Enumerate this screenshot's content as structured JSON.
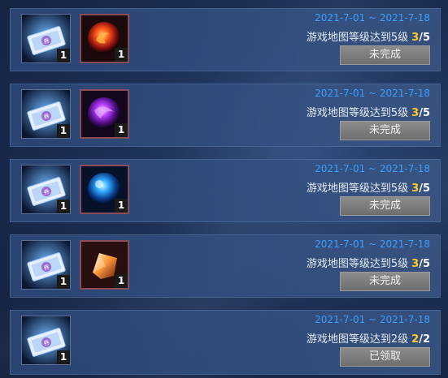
{
  "tasks": [
    {
      "date_range": "2021-7-01 ~ 2021-7-18",
      "task_text": "游戏地图等级达到5级",
      "progress_current": "3",
      "progress_sep": "/",
      "progress_goal": "5",
      "status_label": "未完成",
      "ticket_count": "1",
      "reward_icon": "fire-orb-icon",
      "reward_count": "1"
    },
    {
      "date_range": "2021-7-01 ~ 2021-7-18",
      "task_text": "游戏地图等级达到5级",
      "progress_current": "3",
      "progress_sep": "/",
      "progress_goal": "5",
      "status_label": "未完成",
      "ticket_count": "1",
      "reward_icon": "purple-orb-icon",
      "reward_count": "1"
    },
    {
      "date_range": "2021-7-01 ~ 2021-7-18",
      "task_text": "游戏地图等级达到5级",
      "progress_current": "3",
      "progress_sep": "/",
      "progress_goal": "5",
      "status_label": "未完成",
      "ticket_count": "1",
      "reward_icon": "blue-orb-icon",
      "reward_count": "1"
    },
    {
      "date_range": "2021-7-01 ~ 2021-7-18",
      "task_text": "游戏地图等级达到5级",
      "progress_current": "3",
      "progress_sep": "/",
      "progress_goal": "5",
      "status_label": "未完成",
      "ticket_count": "1",
      "reward_icon": "amber-crystal-icon",
      "reward_count": "1"
    },
    {
      "date_range": "2021-7-01 ~ 2021-7-18",
      "task_text": "游戏地图等级达到2级",
      "progress_current": "2",
      "progress_sep": "/",
      "progress_goal": "2",
      "status_label": "已领取",
      "ticket_count": "1"
    }
  ],
  "colors": {
    "date": "#3aa0ff",
    "progress_current": "#ffcc22",
    "button_bg": "#7a7a7a"
  }
}
